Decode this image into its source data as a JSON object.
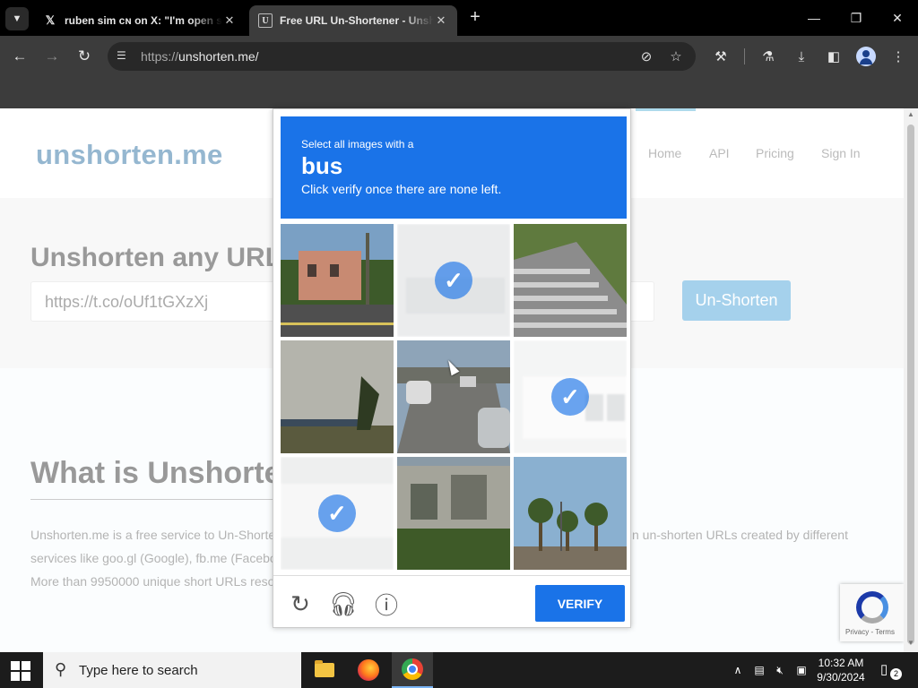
{
  "browser": {
    "tabs": [
      {
        "title": "ruben sim ᴄɴ on X: \"I'm open sourcing",
        "favicon": "x-logo-icon"
      },
      {
        "title": "Free URL Un-Shortener - Unshorten.me",
        "favicon": "unshorten-favicon"
      }
    ],
    "active_tab_index": 1,
    "url_scheme": "https://",
    "url_host": "unshorten.me/"
  },
  "site": {
    "logo": "unshorten.me",
    "nav": [
      "Home",
      "API",
      "Pricing",
      "Sign In"
    ],
    "hero_title": "Unshorten any URL",
    "url_input_value": "https://t.co/oUf1tGXzXj",
    "unshorten_button": "Un-Shorten",
    "about_title": "What is Unshorten.me",
    "about_lines": [
      "Unshorten.me is a free service to Un-Shorten",
      "n un-shorten URLs created by different",
      "services like goo.gl (Google), fb.me (Facebo",
      "More than 9950000 unique short URLs reso"
    ],
    "recaptcha_terms": "Privacy - Terms"
  },
  "captcha": {
    "instruction_line1": "Select all images with a",
    "target_object": "bus",
    "instruction_line3": "Click verify once there are none left.",
    "tiles": [
      {
        "selected": false,
        "scene": "houses-street"
      },
      {
        "selected": true,
        "scene": "faded"
      },
      {
        "selected": false,
        "scene": "stairs"
      },
      {
        "selected": false,
        "scene": "roadside-dusk"
      },
      {
        "selected": false,
        "scene": "street-cars"
      },
      {
        "selected": true,
        "scene": "white-bus"
      },
      {
        "selected": true,
        "scene": "faded"
      },
      {
        "selected": false,
        "scene": "house-lawn"
      },
      {
        "selected": false,
        "scene": "palm-trees"
      }
    ],
    "verify_button": "VERIFY",
    "footer_icons": [
      "reload-icon",
      "headphones-icon",
      "info-icon"
    ],
    "colors": {
      "accent": "#1a73e8"
    }
  },
  "taskbar": {
    "search_placeholder": "Type here to search",
    "time": "10:32 AM",
    "date": "9/30/2024",
    "notification_count": "2"
  }
}
